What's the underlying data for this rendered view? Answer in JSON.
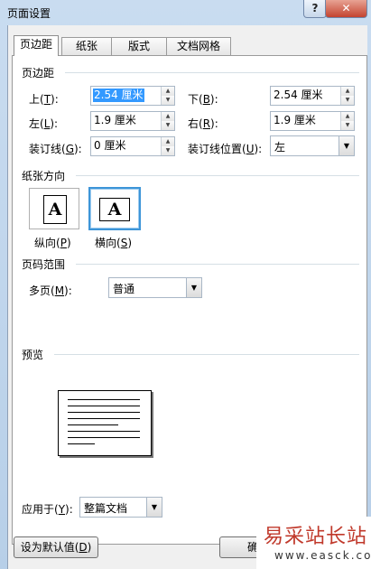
{
  "window": {
    "title": "页面设置",
    "help": "?",
    "close": "✕"
  },
  "tabs": [
    "页边距",
    "纸张",
    "版式",
    "文档网格"
  ],
  "margins": {
    "section": "页边距",
    "top_label": "上(T):",
    "top_value": "2.54 厘米",
    "bottom_label": "下(B):",
    "bottom_value": "2.54 厘米",
    "left_label": "左(L):",
    "left_value": "1.9 厘米",
    "right_label": "右(R):",
    "right_value": "1.9 厘米",
    "gutter_label": "装订线(G):",
    "gutter_value": "0 厘米",
    "gutter_pos_label": "装订线位置(U):",
    "gutter_pos_value": "左"
  },
  "orientation": {
    "section": "纸张方向",
    "glyph": "A",
    "portrait": "纵向(P)",
    "landscape": "横向(S)",
    "selected": "landscape"
  },
  "pages": {
    "section": "页码范围",
    "multi_label": "多页(M):",
    "multi_value": "普通"
  },
  "preview": {
    "section": "预览"
  },
  "apply": {
    "label": "应用于(Y):",
    "value": "整篇文档"
  },
  "buttons": {
    "default": "设为默认值(D)",
    "ok": "确"
  },
  "watermark": {
    "text": "易采站长站",
    "url": "www.easck.com"
  }
}
